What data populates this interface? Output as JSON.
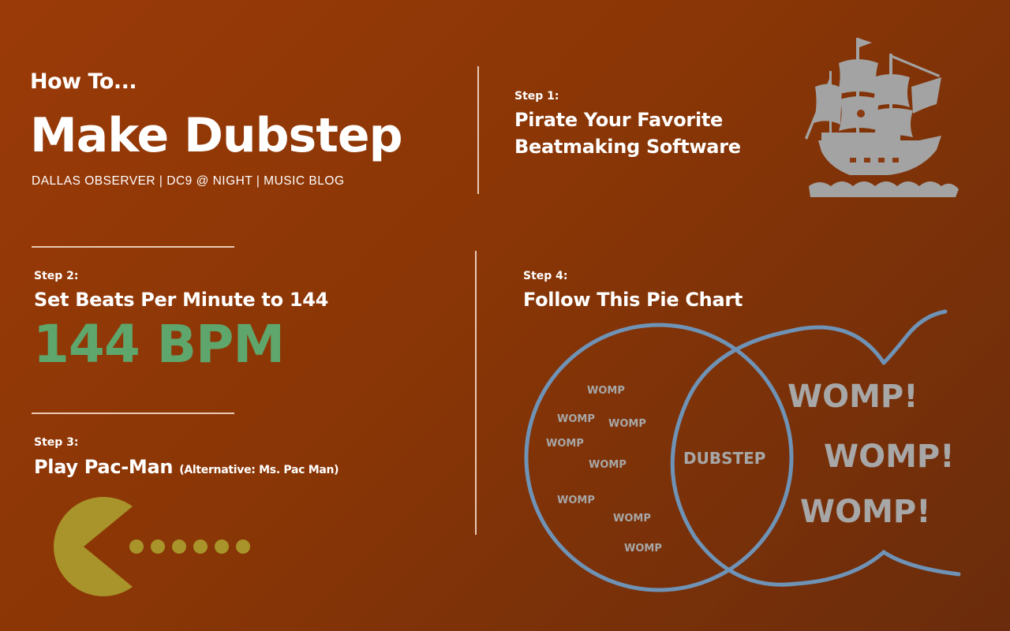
{
  "header": {
    "kicker": "How To...",
    "title": "Make Dubstep",
    "subtitle": "DALLAS OBSERVER | DC9 @ NIGHT  | MUSIC BLOG"
  },
  "step1": {
    "label": "Step 1:",
    "line1": "Pirate Your Favorite",
    "line2": "Beatmaking Software",
    "icon": "pirate-ship-icon"
  },
  "step2": {
    "label": "Step 2:",
    "text": "Set Beats Per Minute to 144",
    "bpm": "144 BPM",
    "bpm_color": "#5fa66c"
  },
  "step3": {
    "label": "Step 3:",
    "text": "Play Pac-Man",
    "alt": "(Alternative: Ms. Pac Man)",
    "icon": "pac-man-icon",
    "pac_color": "#a8942a"
  },
  "step4": {
    "label": "Step 4:",
    "text": "Follow This Pie Chart",
    "center": "DUBSTEP",
    "small_womps": [
      "WOMP",
      "WOMP",
      "WOMP",
      "WOMP",
      "WOMP",
      "WOMP",
      "WOMP",
      "WOMP"
    ],
    "big_womps": [
      "WOMP!",
      "WOMP!",
      "WOMP!"
    ],
    "circle_color": "#6f93b6",
    "text_color": "#a7a7a7"
  }
}
